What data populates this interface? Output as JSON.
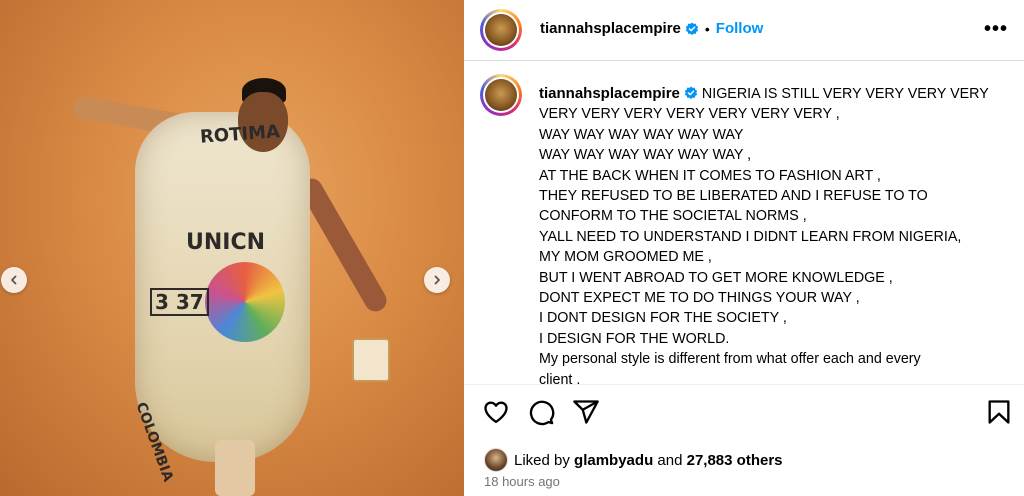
{
  "post": {
    "account": "tiannahsplacempire",
    "follow_label": "Follow",
    "separator": "•",
    "more_label": "•••",
    "caption_lines": [
      "NIGERIA IS STILL VERY VERY VERY VERY",
      "VERY VERY VERY VERY VERY VERY VERY ,",
      "WAY WAY WAY WAY WAY WAY",
      "WAY WAY WAY WAY WAY WAY ,",
      "AT THE BACK WHEN IT COMES TO FASHION ART ,",
      "THEY REFUSED TO BE LIBERATED AND I REFUSE TO TO",
      "CONFORM TO THE SOCIETAL NORMS ,",
      "YALL NEED TO UNDERSTAND I DIDNT LEARN FROM NIGERIA,",
      "MY MOM GROOMED ME ,",
      "BUT I WENT ABROAD TO GET MORE KNOWLEDGE ,",
      "DONT EXPECT ME TO DO THINGS YOUR WAY ,",
      "I DONT DESIGN FOR THE SOCIETY ,",
      "I DESIGN FOR THE WORLD.",
      "My personal style is different from what offer each and every",
      "client ,"
    ],
    "liked_by_prefix": "Liked by",
    "liked_by_user": "glambyadu",
    "liked_by_and": "and",
    "liked_by_others": "27,883 others",
    "timestamp": "18 hours ago"
  },
  "media": {
    "stamp_top": "ROTIMA",
    "stamp_mid": "UNICN",
    "stamp_num": "3 37",
    "stamp_bottom": "COLOMBIA"
  },
  "icons": {
    "like": "heart-icon",
    "comment": "comment-icon",
    "share": "share-icon",
    "save": "bookmark-icon",
    "verified": "verified-badge-icon",
    "prev": "chevron-left-icon",
    "next": "chevron-right-icon"
  },
  "colors": {
    "follow": "#0095f6",
    "verified": "#0095f6",
    "muted": "#737373",
    "divider": "#dbdbdb"
  }
}
